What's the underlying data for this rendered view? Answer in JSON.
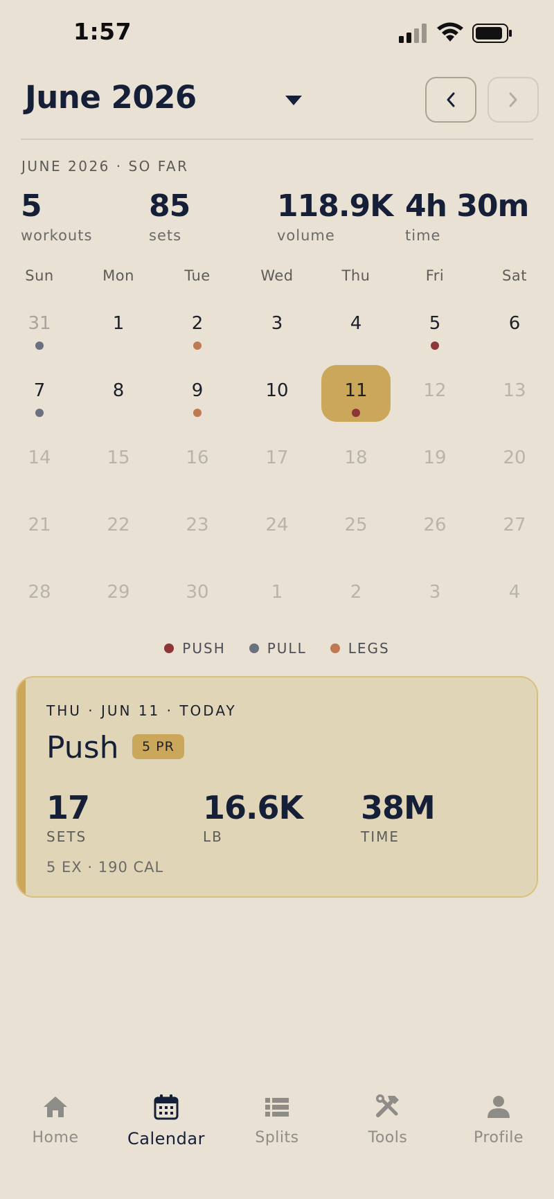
{
  "status_bar": {
    "time": "1:57"
  },
  "header": {
    "title": "June 2026"
  },
  "summary": {
    "label": "JUNE 2026 · SO FAR",
    "stats": [
      {
        "value": "5",
        "label": "workouts"
      },
      {
        "value": "85",
        "label": "sets"
      },
      {
        "value": "118.9K",
        "label": "volume"
      },
      {
        "value": "4h 30m",
        "label": "time"
      }
    ]
  },
  "weekdays": [
    "Sun",
    "Mon",
    "Tue",
    "Wed",
    "Thu",
    "Fri",
    "Sat"
  ],
  "calendar": {
    "weeks": [
      [
        {
          "day": "31",
          "state": "outside",
          "dot": "pull"
        },
        {
          "day": "1",
          "state": "normal"
        },
        {
          "day": "2",
          "state": "normal",
          "dot": "legs"
        },
        {
          "day": "3",
          "state": "normal"
        },
        {
          "day": "4",
          "state": "normal"
        },
        {
          "day": "5",
          "state": "normal",
          "dot": "push"
        },
        {
          "day": "6",
          "state": "normal"
        }
      ],
      [
        {
          "day": "7",
          "state": "normal",
          "dot": "pull"
        },
        {
          "day": "8",
          "state": "normal"
        },
        {
          "day": "9",
          "state": "normal",
          "dot": "legs"
        },
        {
          "day": "10",
          "state": "normal"
        },
        {
          "day": "11",
          "state": "today",
          "dot": "push"
        },
        {
          "day": "12",
          "state": "faded"
        },
        {
          "day": "13",
          "state": "faded"
        }
      ],
      [
        {
          "day": "14",
          "state": "faded"
        },
        {
          "day": "15",
          "state": "faded"
        },
        {
          "day": "16",
          "state": "faded"
        },
        {
          "day": "17",
          "state": "faded"
        },
        {
          "day": "18",
          "state": "faded"
        },
        {
          "day": "19",
          "state": "faded"
        },
        {
          "day": "20",
          "state": "faded"
        }
      ],
      [
        {
          "day": "21",
          "state": "faded"
        },
        {
          "day": "22",
          "state": "faded"
        },
        {
          "day": "23",
          "state": "faded"
        },
        {
          "day": "24",
          "state": "faded"
        },
        {
          "day": "25",
          "state": "faded"
        },
        {
          "day": "26",
          "state": "faded"
        },
        {
          "day": "27",
          "state": "faded"
        }
      ],
      [
        {
          "day": "28",
          "state": "faded"
        },
        {
          "day": "29",
          "state": "faded"
        },
        {
          "day": "30",
          "state": "faded"
        },
        {
          "day": "1",
          "state": "faded"
        },
        {
          "day": "2",
          "state": "faded"
        },
        {
          "day": "3",
          "state": "faded"
        },
        {
          "day": "4",
          "state": "faded"
        }
      ]
    ]
  },
  "legend": [
    {
      "key": "push",
      "label": "PUSH"
    },
    {
      "key": "pull",
      "label": "PULL"
    },
    {
      "key": "legs",
      "label": "LEGS"
    }
  ],
  "colors": {
    "push": "#8f3438",
    "pull": "#6a7080",
    "legs": "#c07a53",
    "accent": "#caa75a"
  },
  "workout_card": {
    "date_line": "THU · JUN 11 · TODAY",
    "title": "Push",
    "pr_badge": "5 PR",
    "stats": [
      {
        "value": "17",
        "label": "SETS"
      },
      {
        "value": "16.6K",
        "label": "LB"
      },
      {
        "value": "38M",
        "label": "TIME"
      }
    ],
    "footer": "5 EX · 190 CAL"
  },
  "tabs": [
    {
      "label": "Home",
      "icon": "home-icon",
      "active": false
    },
    {
      "label": "Calendar",
      "icon": "calendar-icon",
      "active": true
    },
    {
      "label": "Splits",
      "icon": "list-icon",
      "active": false
    },
    {
      "label": "Tools",
      "icon": "tools-icon",
      "active": false
    },
    {
      "label": "Profile",
      "icon": "person-icon",
      "active": false
    }
  ]
}
